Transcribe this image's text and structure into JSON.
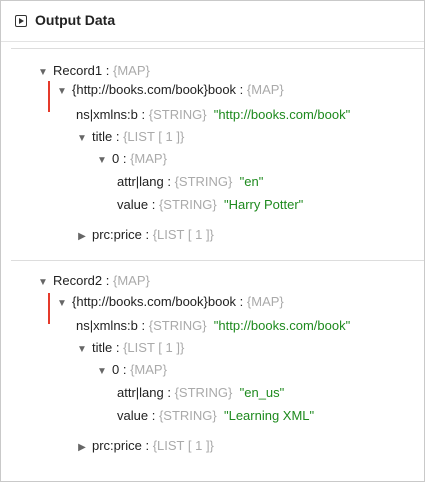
{
  "header": {
    "title": "Output Data"
  },
  "records": [
    {
      "label": "Record1 :",
      "type": "{MAP}",
      "book_label": "{http://books.com/book}book :",
      "book_type": "{MAP}",
      "ns_label": "ns|xmlns:b :",
      "ns_type": "{STRING}",
      "ns_value": "\"http://books.com/book\"",
      "title_label": "title :",
      "title_type": "{LIST [ 1 ]}",
      "item_label": "0 :",
      "item_type": "{MAP}",
      "attr_label": "attr|lang :",
      "attr_type": "{STRING}",
      "attr_value": "\"en\"",
      "value_label": "value :",
      "value_type": "{STRING}",
      "value_value": "\"Harry Potter\"",
      "price_label": "prc:price :",
      "price_type": "{LIST [ 1 ]}"
    },
    {
      "label": "Record2 :",
      "type": "{MAP}",
      "book_label": "{http://books.com/book}book :",
      "book_type": "{MAP}",
      "ns_label": "ns|xmlns:b :",
      "ns_type": "{STRING}",
      "ns_value": "\"http://books.com/book\"",
      "title_label": "title :",
      "title_type": "{LIST [ 1 ]}",
      "item_label": "0 :",
      "item_type": "{MAP}",
      "attr_label": "attr|lang :",
      "attr_type": "{STRING}",
      "attr_value": "\"en_us\"",
      "value_label": "value :",
      "value_type": "{STRING}",
      "value_value": "\"Learning XML\"",
      "price_label": "prc:price :",
      "price_type": "{LIST [ 1 ]}"
    }
  ]
}
